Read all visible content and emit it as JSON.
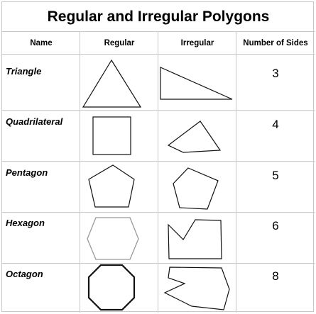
{
  "title": "Regular and Irregular Polygons",
  "headers": {
    "name": "Name",
    "regular": "Regular",
    "irregular": "Irregular",
    "sides": "Number of Sides"
  },
  "rows": [
    {
      "name": "Triangle",
      "sides": "3"
    },
    {
      "name": "Quadrilateral",
      "sides": "4"
    },
    {
      "name": "Pentagon",
      "sides": "5"
    },
    {
      "name": "Hexagon",
      "sides": "6"
    },
    {
      "name": "Octagon",
      "sides": "8"
    }
  ]
}
